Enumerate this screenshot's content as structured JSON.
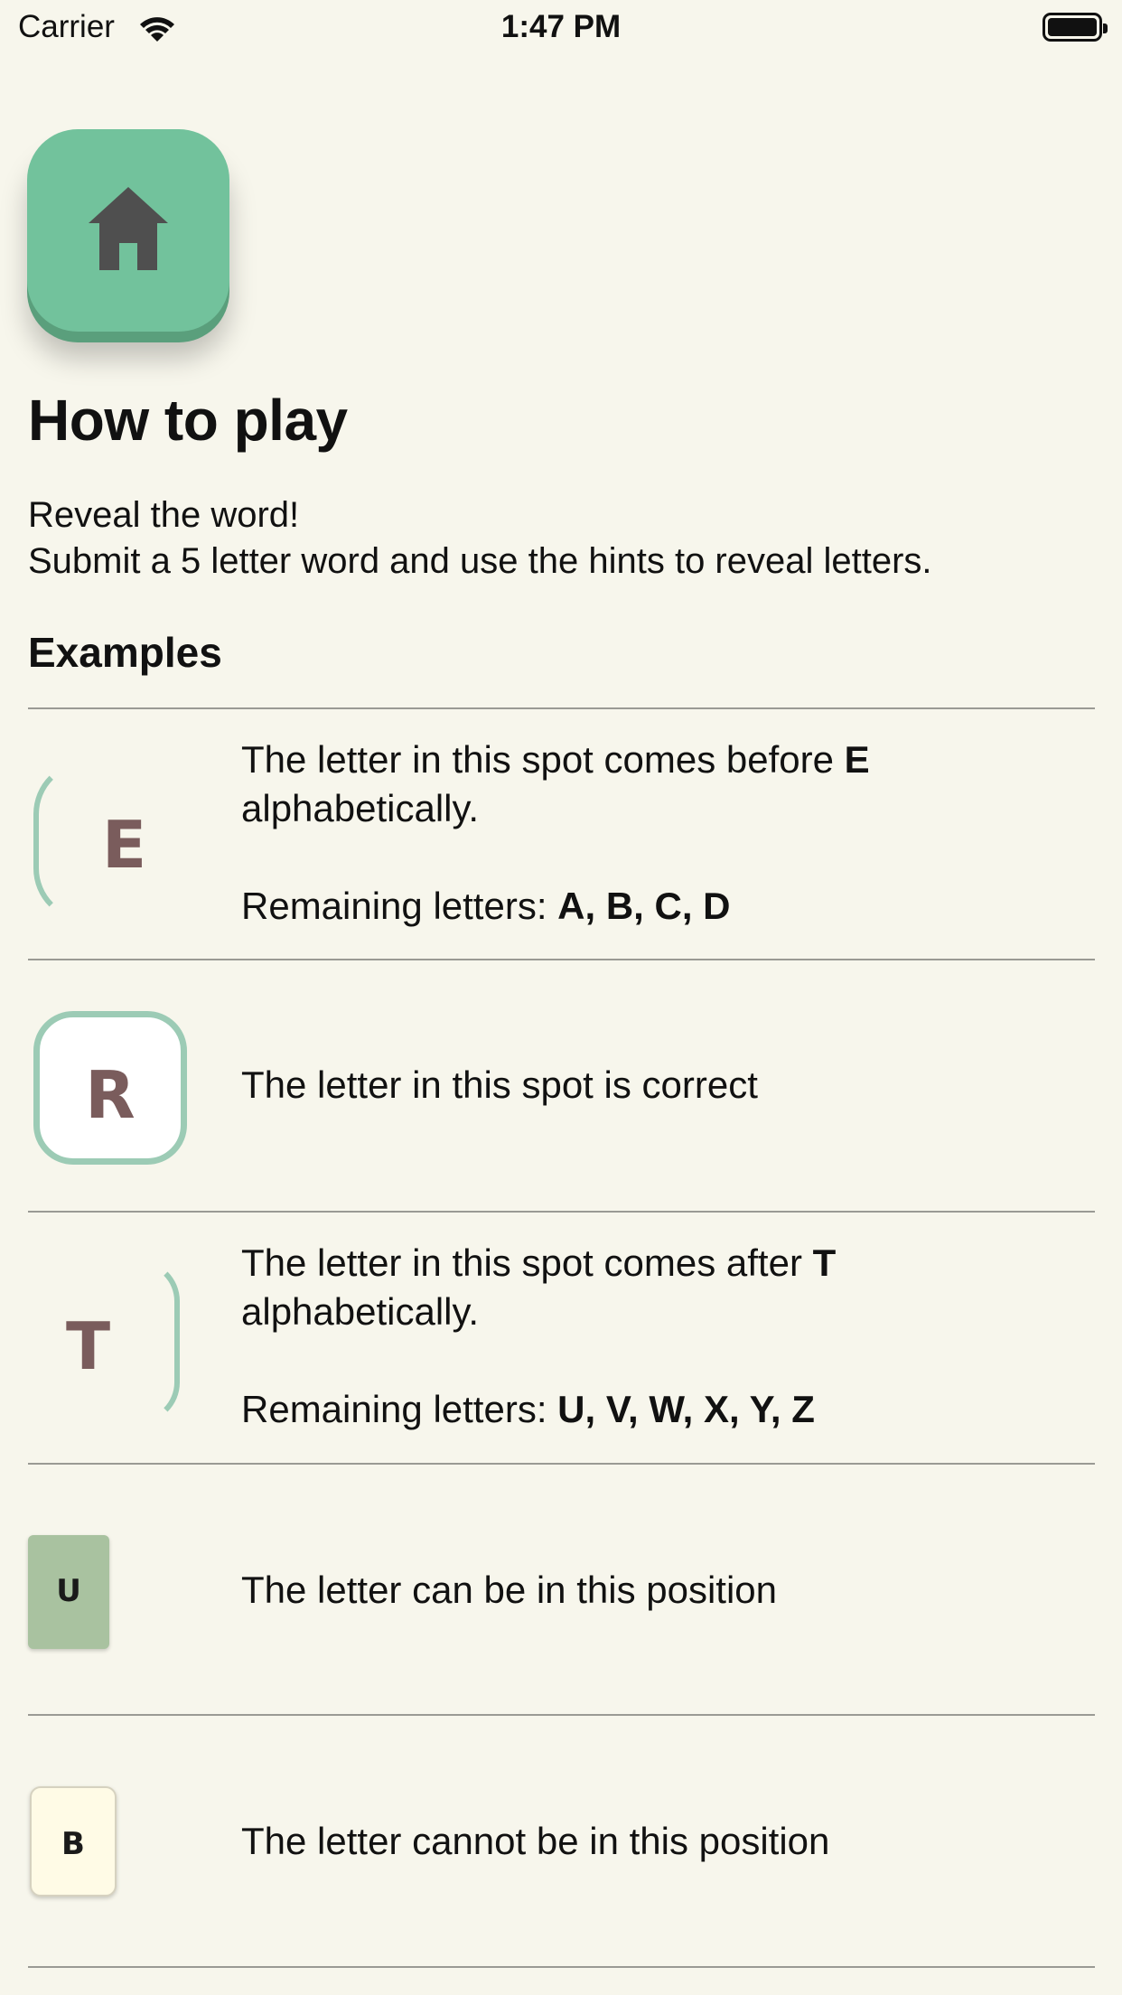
{
  "status_bar": {
    "carrier": "Carrier",
    "time": "1:47 PM",
    "wifi_icon": "wifi-icon",
    "battery_icon": "battery-icon"
  },
  "home_button": {
    "icon": "home-icon",
    "color": "#72c29c"
  },
  "title": "How to play",
  "intro": {
    "line1": "Reveal the word!",
    "line2": "Submit a 5 letter word and use the hints to reveal letters."
  },
  "examples_heading": "Examples",
  "examples": [
    {
      "tile_letter": "E",
      "text_before": "The letter in this spot comes before ",
      "text_bold": "E",
      "text_line2": "alphabetically.",
      "remaining_label": "Remaining letters: ",
      "remaining_letters": "A, B, C, D"
    },
    {
      "tile_letter": "R",
      "text": "The letter in this spot is correct"
    },
    {
      "tile_letter": "T",
      "text_before": "The letter in this spot comes after ",
      "text_bold": "T",
      "text_line2": "alphabetically.",
      "remaining_label": "Remaining letters: ",
      "remaining_letters": "U, V, W, X, Y, Z"
    },
    {
      "tile_letter": "U",
      "text": "The letter can be in this position"
    },
    {
      "tile_letter": "B",
      "text": "The letter cannot be in this position"
    }
  ],
  "colors": {
    "background": "#f7f6ec",
    "accent_green": "#72c29c",
    "tile_outline": "#9ccbb5",
    "tile_can": "#a9c2a0",
    "tile_cannot": "#fffbe6"
  }
}
